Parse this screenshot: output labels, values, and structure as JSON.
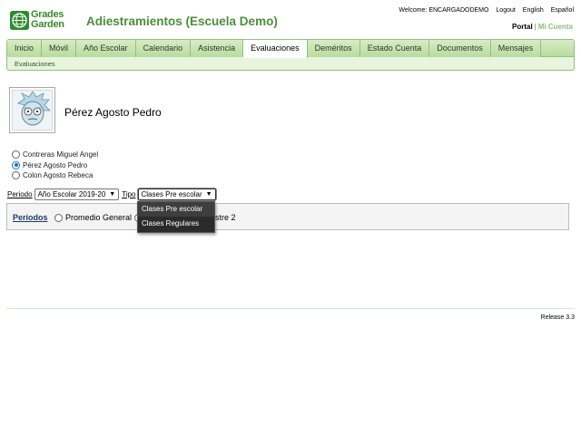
{
  "header": {
    "logo_line1": "Grades",
    "logo_line2": "Garden",
    "title": "Adiestramientos (Escuela Demo)",
    "welcome": "Welcome: ENCARGADODEMO",
    "logout": "Logout",
    "english": "English",
    "espanol": "Español",
    "portal": "Portal",
    "separator": "|",
    "mi_cuenta": "Mi Cuenta"
  },
  "nav": {
    "tabs": [
      "Inicio",
      "Móvil",
      "Año Escolar",
      "Calendario",
      "Asistencia",
      "Evaluaciones",
      "Deméritos",
      "Estado Cuenta",
      "Documentos",
      "Mensajes"
    ],
    "active_tab": "Evaluaciones",
    "subnav": "Evaluaciones"
  },
  "student": {
    "name": "Pérez Agosto Pedro",
    "options": [
      {
        "label": "Contreras Miguel Angel",
        "selected": false
      },
      {
        "label": "Pérez Agosto Pedro",
        "selected": true
      },
      {
        "label": "Colon Agosto Rebeca",
        "selected": false
      }
    ]
  },
  "filters": {
    "periodo_label": "Periodo",
    "periodo_value": "Año Escolar 2019-20",
    "tipo_label": "Tipo",
    "tipo_value": "Clases Pre escolar",
    "tipo_options": [
      "Clases Pre escolar",
      "Clases Regulares"
    ]
  },
  "periods": {
    "label": "Periodos",
    "options": [
      "Promedio General",
      "Semestre 2"
    ],
    "partial_visible": "estre 2"
  },
  "footer": {
    "release": "Release 3.3"
  },
  "colors": {
    "brand_green": "#4a8f3a",
    "nav_border": "#8cc47a",
    "link_blue": "#1b3a6a",
    "dropdown_bg": "#2b2b2b"
  }
}
